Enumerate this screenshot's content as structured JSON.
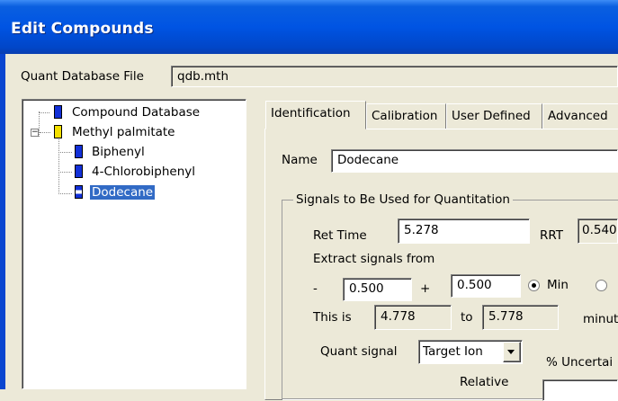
{
  "window": {
    "title": "Edit Compounds"
  },
  "quant_db": {
    "label": "Quant Database File",
    "value": "qdb.mth"
  },
  "tree": {
    "root": "Compound Database",
    "parent": "Methyl palmitate",
    "children": [
      "Biphenyl",
      "4-Chlorobiphenyl",
      "Dodecane"
    ],
    "selected": "Dodecane"
  },
  "tabs": [
    "Identification",
    "Calibration",
    "User Defined",
    "Advanced"
  ],
  "active_tab": "Identification",
  "name": {
    "label": "Name",
    "value": "Dodecane"
  },
  "signals": {
    "group_title": "Signals to Be Used for Quantitation",
    "ret_time_label": "Ret Time",
    "ret_time_value": "5.278",
    "rrt_label": "RRT",
    "rrt_value": "0.540",
    "extract_label": "Extract signals from",
    "minus": "-",
    "minus_value": "0.500",
    "plus": "+",
    "plus_value": "0.500",
    "min_label": "Min",
    "this_is_label": "This is",
    "this_is_value": "4.778",
    "to_label": "to",
    "to_value": "5.778",
    "minutes_label": "minut",
    "quant_signal_label": "Quant signal",
    "quant_signal_value": "Target Ion",
    "uncertainty_label": "% Uncertai",
    "relative_label": "Relative"
  }
}
